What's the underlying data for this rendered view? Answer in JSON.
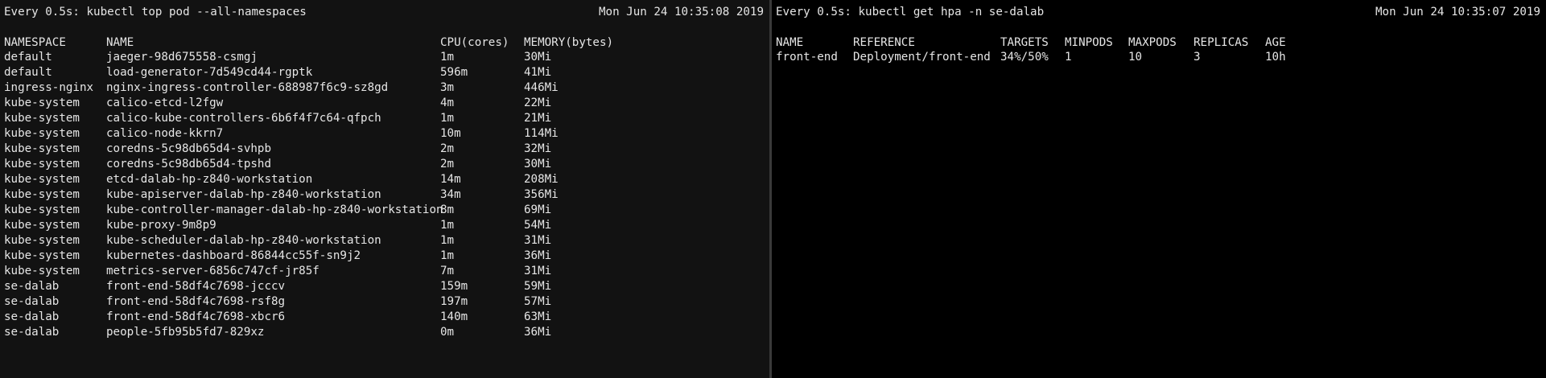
{
  "left_pane": {
    "watch_header": "Every 0.5s: kubectl top pod --all-namespaces",
    "timestamp": "Mon Jun 24 10:35:08 2019",
    "columns": [
      "NAMESPACE",
      "NAME",
      "CPU(cores)",
      "MEMORY(bytes)"
    ],
    "rows": [
      [
        "default",
        "jaeger-98d675558-csmgj",
        "1m",
        "30Mi"
      ],
      [
        "default",
        "load-generator-7d549cd44-rgptk",
        "596m",
        "41Mi"
      ],
      [
        "ingress-nginx",
        "nginx-ingress-controller-688987f6c9-sz8gd",
        "3m",
        "446Mi"
      ],
      [
        "kube-system",
        "calico-etcd-l2fgw",
        "4m",
        "22Mi"
      ],
      [
        "kube-system",
        "calico-kube-controllers-6b6f4f7c64-qfpch",
        "1m",
        "21Mi"
      ],
      [
        "kube-system",
        "calico-node-kkrn7",
        "10m",
        "114Mi"
      ],
      [
        "kube-system",
        "coredns-5c98db65d4-svhpb",
        "2m",
        "32Mi"
      ],
      [
        "kube-system",
        "coredns-5c98db65d4-tpshd",
        "2m",
        "30Mi"
      ],
      [
        "kube-system",
        "etcd-dalab-hp-z840-workstation",
        "14m",
        "208Mi"
      ],
      [
        "kube-system",
        "kube-apiserver-dalab-hp-z840-workstation",
        "34m",
        "356Mi"
      ],
      [
        "kube-system",
        "kube-controller-manager-dalab-hp-z840-workstation",
        "8m",
        "69Mi"
      ],
      [
        "kube-system",
        "kube-proxy-9m8p9",
        "1m",
        "54Mi"
      ],
      [
        "kube-system",
        "kube-scheduler-dalab-hp-z840-workstation",
        "1m",
        "31Mi"
      ],
      [
        "kube-system",
        "kubernetes-dashboard-86844cc55f-sn9j2",
        "1m",
        "36Mi"
      ],
      [
        "kube-system",
        "metrics-server-6856c747cf-jr85f",
        "7m",
        "31Mi"
      ],
      [
        "se-dalab",
        "front-end-58df4c7698-jcccv",
        "159m",
        "59Mi"
      ],
      [
        "se-dalab",
        "front-end-58df4c7698-rsf8g",
        "197m",
        "57Mi"
      ],
      [
        "se-dalab",
        "front-end-58df4c7698-xbcr6",
        "140m",
        "63Mi"
      ],
      [
        "se-dalab",
        "people-5fb95b5fd7-829xz",
        "0m",
        "36Mi"
      ]
    ]
  },
  "right_pane": {
    "watch_header": "Every 0.5s: kubectl get hpa -n se-dalab",
    "timestamp": "Mon Jun 24 10:35:07 2019",
    "columns": [
      "NAME",
      "REFERENCE",
      "TARGETS",
      "MINPODS",
      "MAXPODS",
      "REPLICAS",
      "AGE"
    ],
    "rows": [
      [
        "front-end",
        "Deployment/front-end",
        "34%/50%",
        "1",
        "10",
        "3",
        "10h"
      ]
    ]
  },
  "colors": {
    "left_background": "#121212",
    "right_background": "#000000",
    "text": "#e6e6e6"
  }
}
